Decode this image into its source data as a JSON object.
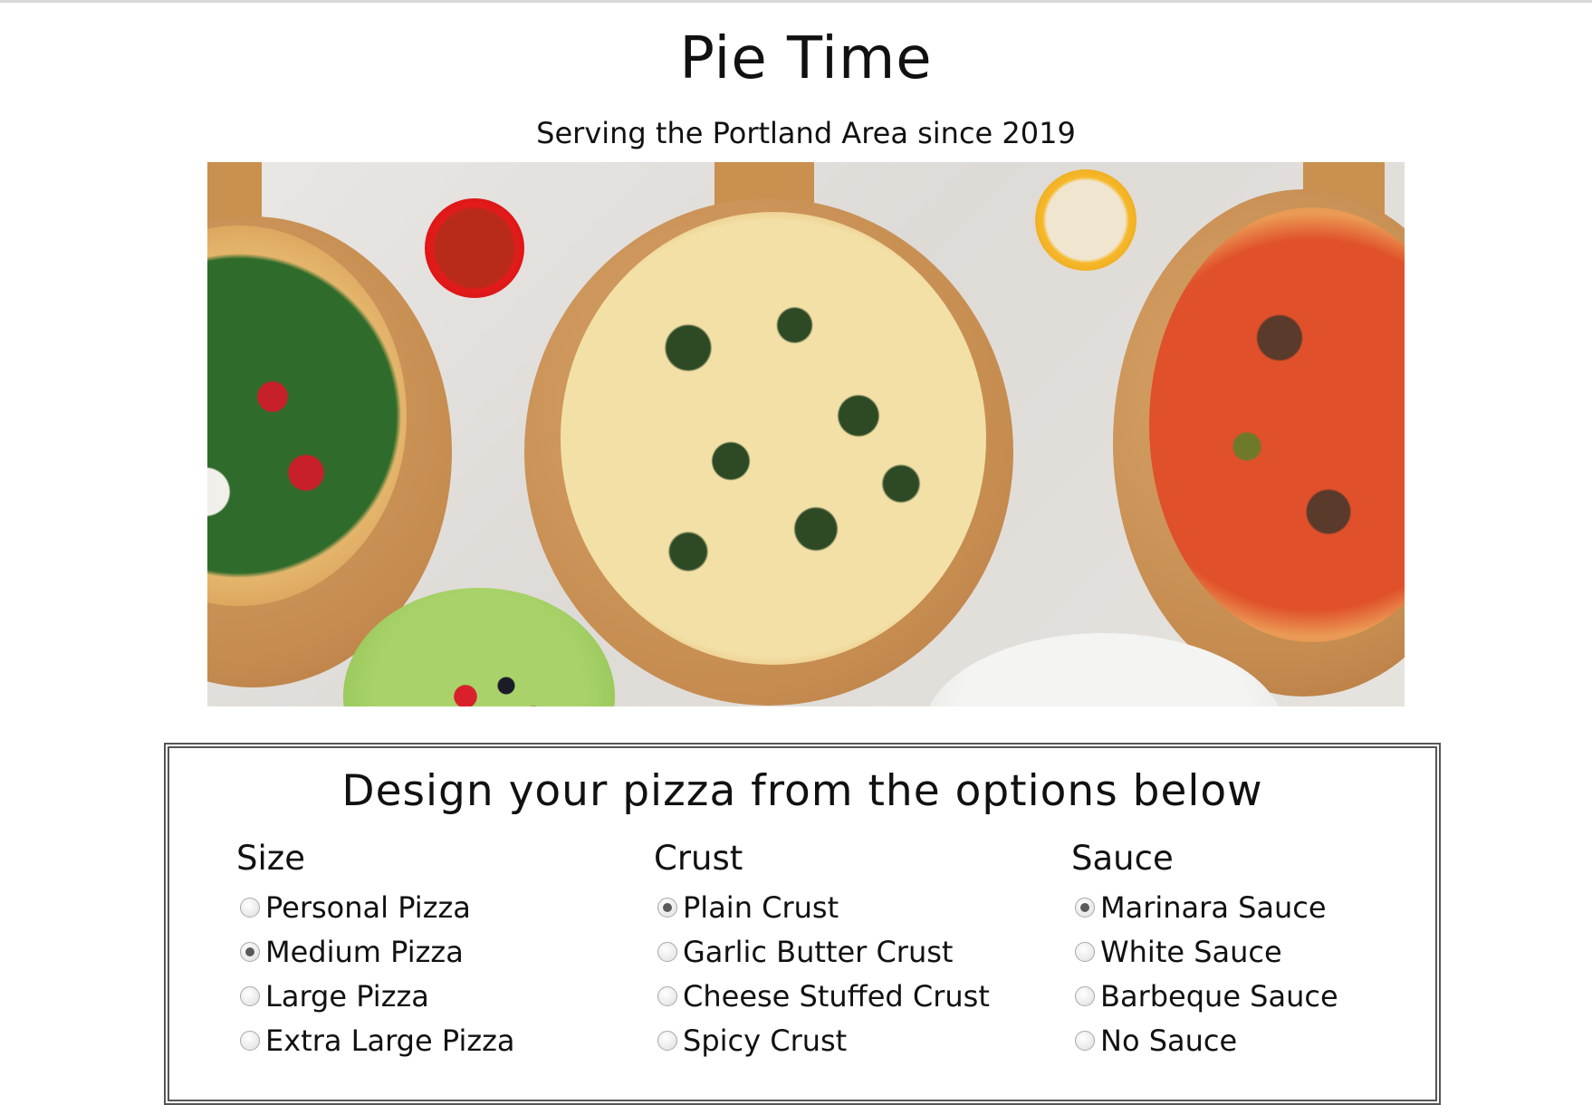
{
  "header": {
    "title": "Pie Time",
    "tagline": "Serving the Portland Area since 2019"
  },
  "form": {
    "heading": "Design your pizza from the options below",
    "size": {
      "label": "Size",
      "options": [
        "Personal Pizza",
        "Medium Pizza",
        "Large Pizza",
        "Extra Large Pizza"
      ],
      "selected": "Medium Pizza"
    },
    "crust": {
      "label": "Crust",
      "options": [
        "Plain Crust",
        "Garlic Butter Crust",
        "Cheese Stuffed Crust",
        "Spicy Crust"
      ],
      "selected": "Plain Crust"
    },
    "sauce": {
      "label": "Sauce",
      "options": [
        "Marinara Sauce",
        "White Sauce",
        "Barbeque Sauce",
        "No Sauce"
      ],
      "selected": "Marinara Sauce"
    }
  }
}
